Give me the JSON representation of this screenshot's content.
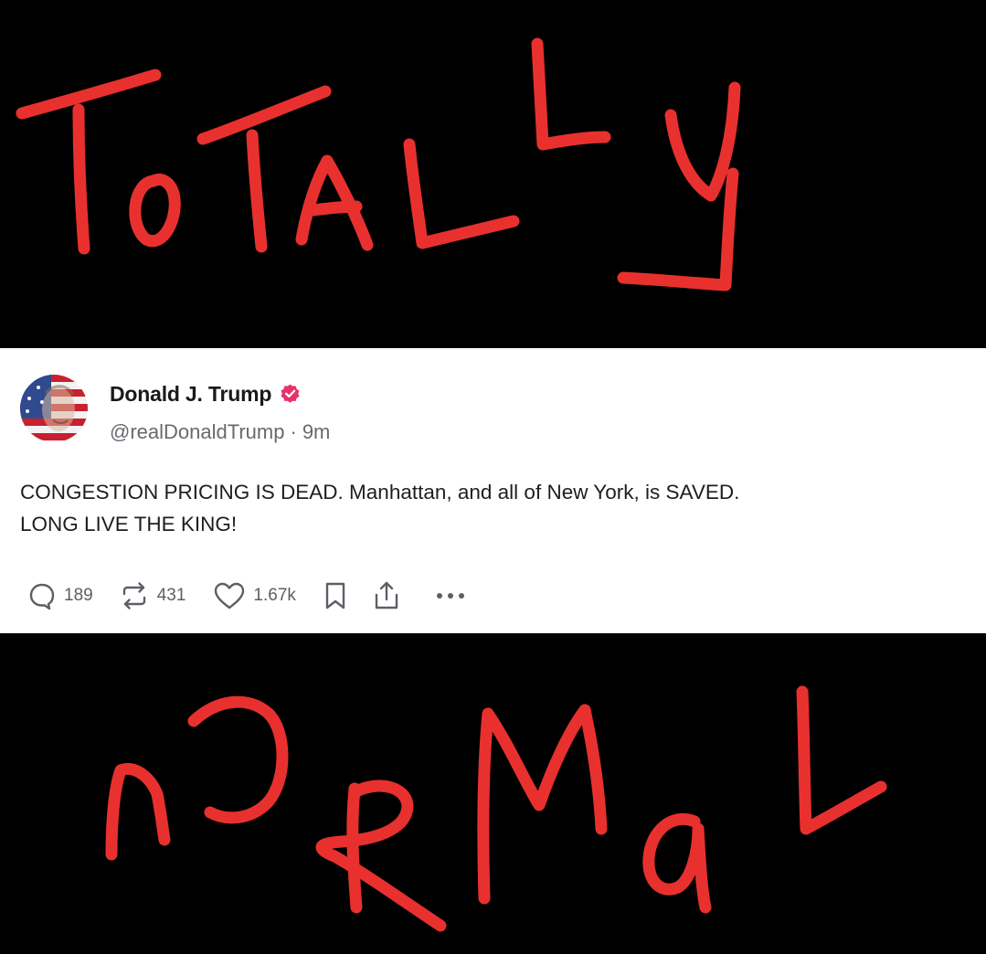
{
  "overlay": {
    "top_scribble": "ToTALLy",
    "bottom_scribble": "nORMaL",
    "scribble_color": "#e8312e",
    "background_color": "#000000"
  },
  "post": {
    "author_name": "Donald J. Trump",
    "verified_badge": "verified-check-icon",
    "verified_color": "#e5336a",
    "handle": "@realDonaldTrump",
    "separator": "·",
    "timestamp": "9m",
    "body_lines": [
      "CONGESTION PRICING IS DEAD. Manhattan, and all of New York, is SAVED.",
      "LONG LIVE THE KING!"
    ],
    "actions": {
      "replies": "189",
      "reposts": "431",
      "likes": "1.67k"
    }
  }
}
